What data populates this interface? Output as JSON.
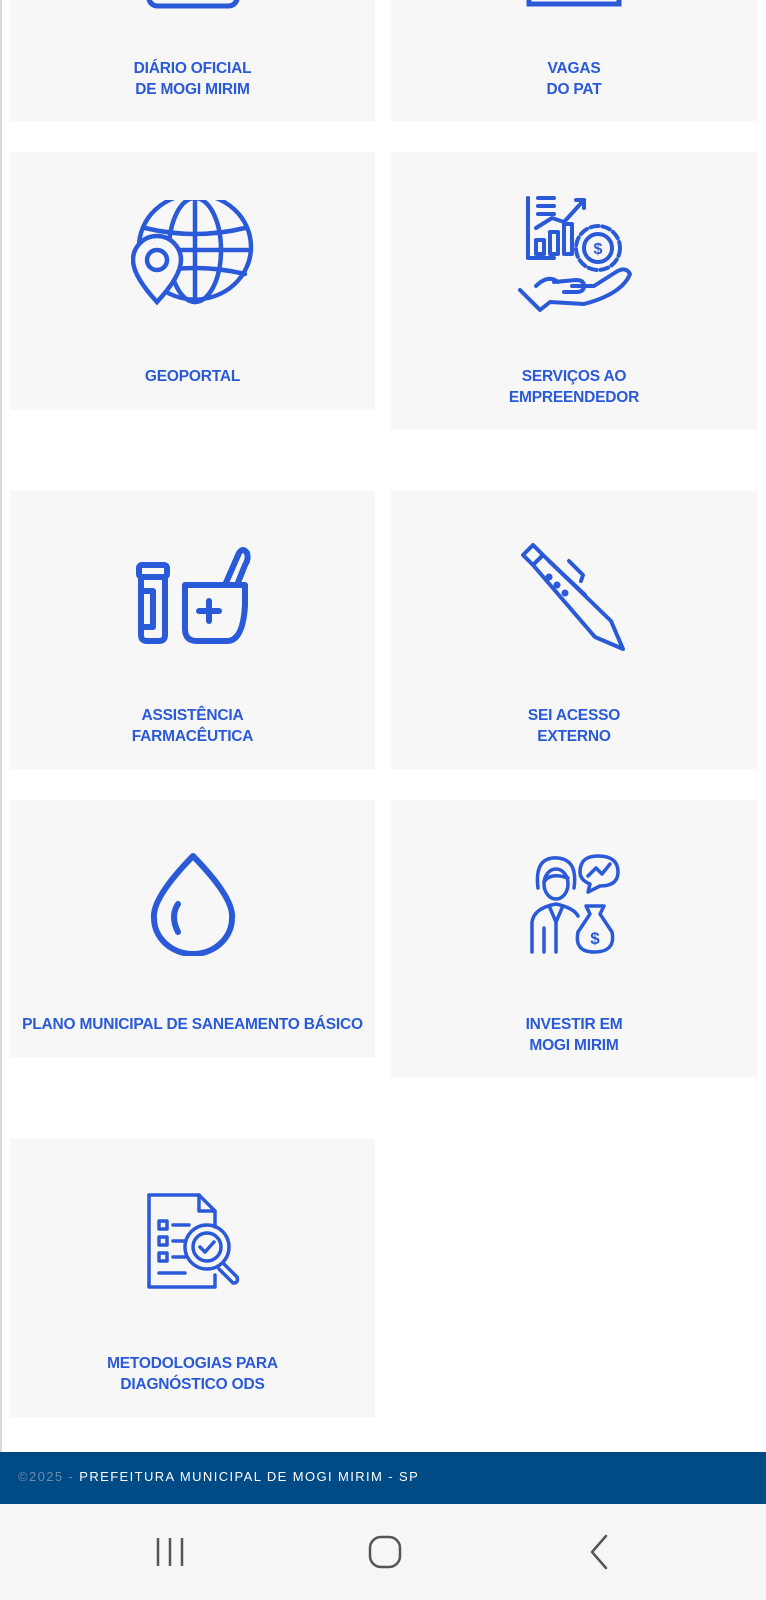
{
  "tiles": [
    {
      "id": "diario",
      "lines": [
        "DIÁRIO OFICIAL",
        "DE MOGI MIRIM"
      ],
      "icon": "newspaper-icon"
    },
    {
      "id": "vagas",
      "lines": [
        "VAGAS",
        "DO PAT"
      ],
      "icon": "briefcase-icon"
    },
    {
      "id": "geoportal",
      "lines": [
        "GEOPORTAL"
      ],
      "icon": "globe-pin-icon"
    },
    {
      "id": "empreendedor",
      "lines": [
        "SERVIÇOS AO",
        "EMPREENDEDOR"
      ],
      "icon": "hand-chart-icon"
    },
    {
      "id": "farmaceutica",
      "lines": [
        "ASSISTÊNCIA",
        "FARMACÊUTICA"
      ],
      "icon": "pharmacy-icon"
    },
    {
      "id": "sei",
      "lines": [
        "SEI ACESSO",
        "EXTERNO"
      ],
      "icon": "pen-icon"
    },
    {
      "id": "saneamento",
      "lines": [
        "PLANO MUNICIPAL DE SANEAMENTO BÁSICO"
      ],
      "icon": "water-drop-icon"
    },
    {
      "id": "investir",
      "lines": [
        "INVESTIR EM",
        "MOGI MIRIM"
      ],
      "icon": "investor-icon"
    },
    {
      "id": "ods",
      "lines": [
        "METODOLOGIAS PARA",
        "DIAGNÓSTICO ODS"
      ],
      "icon": "document-search-icon"
    }
  ],
  "footer": {
    "copyright": "©2025 - ",
    "text": "PREFEITURA MUNICIPAL DE MOGI MIRIM - SP"
  },
  "colors": {
    "accent": "#2a5ad8",
    "tile_bg": "#f7f7f8",
    "footer_bg": "#004a86"
  }
}
